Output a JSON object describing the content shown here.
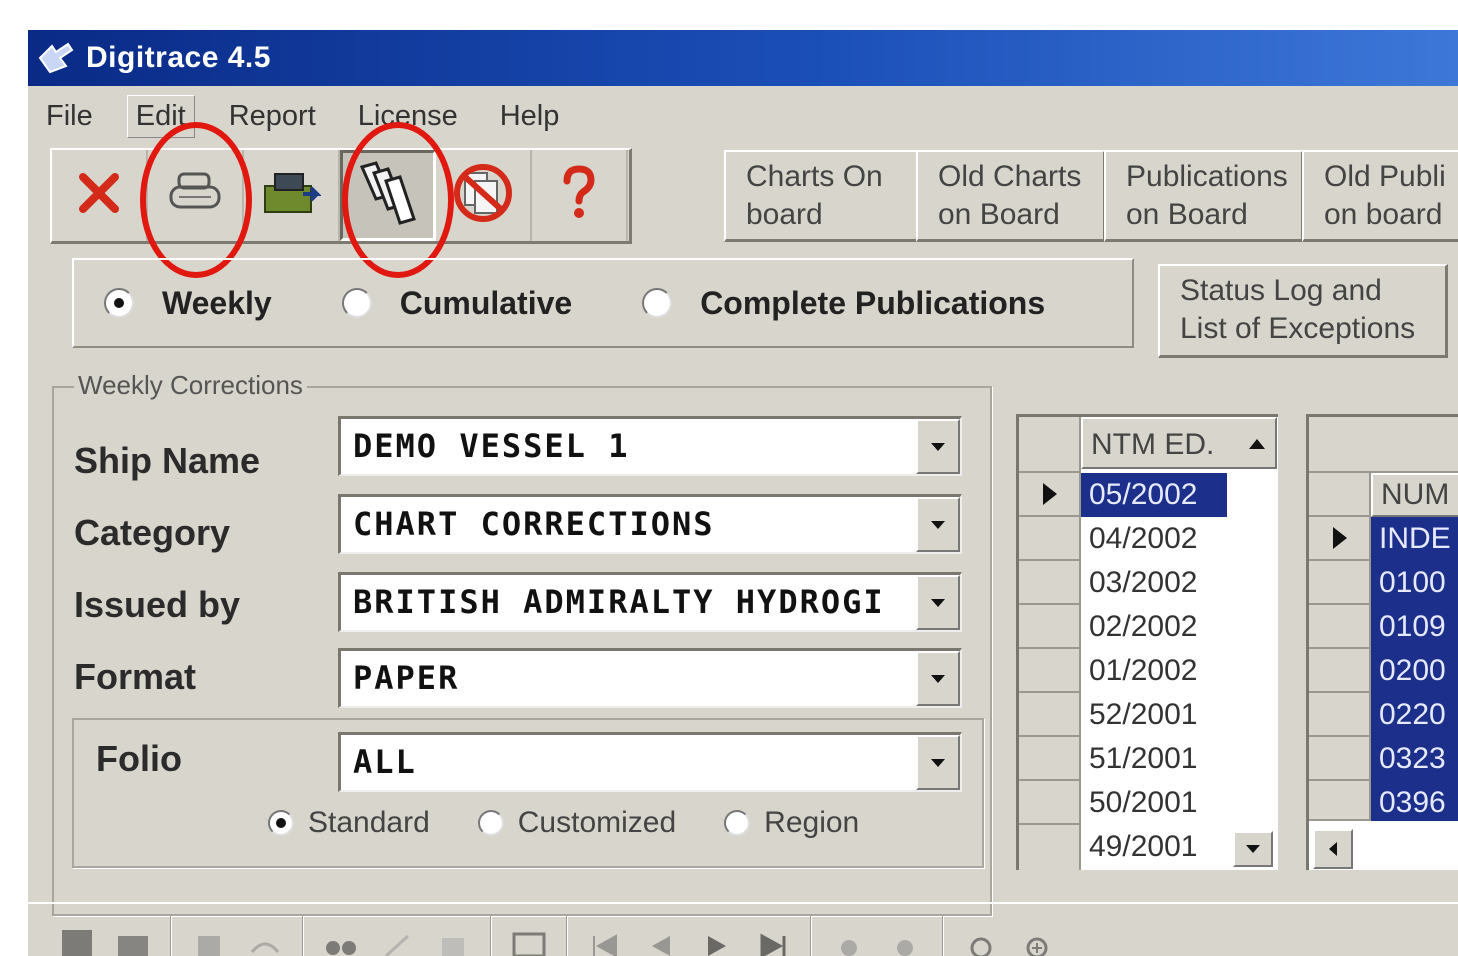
{
  "window": {
    "title": "Digitrace 4.5"
  },
  "menu": {
    "items": [
      "File",
      "Edit",
      "Report",
      "License",
      "Help"
    ]
  },
  "toolbar": {
    "icons": [
      "delete-x-icon",
      "printer-icon",
      "import-icon",
      "copy-pages-icon",
      "no-entry-icon",
      "help-question-icon"
    ],
    "big_buttons": [
      {
        "line1": "Charts On",
        "line2": "board"
      },
      {
        "line1": "Old Charts",
        "line2": "on Board"
      },
      {
        "line1": "Publications",
        "line2": "on Board"
      },
      {
        "line1": "Old Publi",
        "line2": "on board"
      }
    ]
  },
  "mode": {
    "options": [
      "Weekly",
      "Cumulative",
      "Complete Publications"
    ],
    "selected": "Weekly"
  },
  "status_button": {
    "line1": "Status Log and",
    "line2": "List of Exceptions"
  },
  "weekly": {
    "legend": "Weekly Corrections",
    "ship_label": "Ship Name",
    "ship_value": "DEMO VESSEL 1",
    "category_label": "Category",
    "category_value": "CHART CORRECTIONS",
    "issued_label": "Issued by",
    "issued_value": "BRITISH ADMIRALTY HYDROGI",
    "format_label": "Format",
    "format_value": "PAPER",
    "folio_label": "Folio",
    "folio_value": "ALL",
    "folio_options": [
      "Standard",
      "Customized",
      "Region"
    ],
    "folio_selected": "Standard"
  },
  "ntm_grid": {
    "header": "NTM ED.",
    "rows": [
      "05/2002",
      "04/2002",
      "03/2002",
      "02/2002",
      "01/2002",
      "52/2001",
      "51/2001",
      "50/2001",
      "49/2001"
    ],
    "selected_index": 0
  },
  "num_grid": {
    "header": "NUM",
    "rows": [
      "INDE",
      "0100",
      "0109",
      "0200",
      "0220",
      "0323",
      "0396"
    ]
  },
  "colors": {
    "title_bar": "#0a2a86",
    "selection": "#1c2f8a",
    "highlight_circle": "#e01810",
    "face": "#d8d5cc"
  }
}
